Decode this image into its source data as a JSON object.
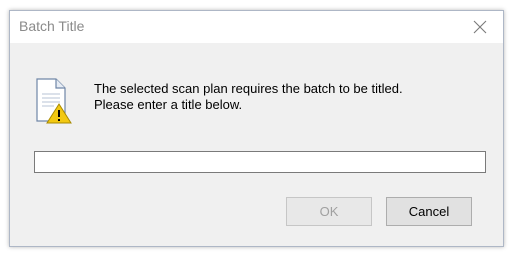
{
  "dialog": {
    "title": "Batch Title",
    "close_icon": "close-icon",
    "message_icon": "document-warning-icon",
    "message_line1": "The selected scan plan requires the batch to be titled.",
    "message_line2": "Please enter a title below.",
    "input_value": "",
    "input_placeholder": "",
    "ok_label": "OK",
    "ok_enabled": false,
    "cancel_label": "Cancel"
  },
  "colors": {
    "dialog_background": "#f0f0f0",
    "titlebar_background": "#ffffff",
    "title_text": "#8a8a8a",
    "warning_yellow": "#f2c811",
    "disabled_text": "#a0a0a0"
  }
}
